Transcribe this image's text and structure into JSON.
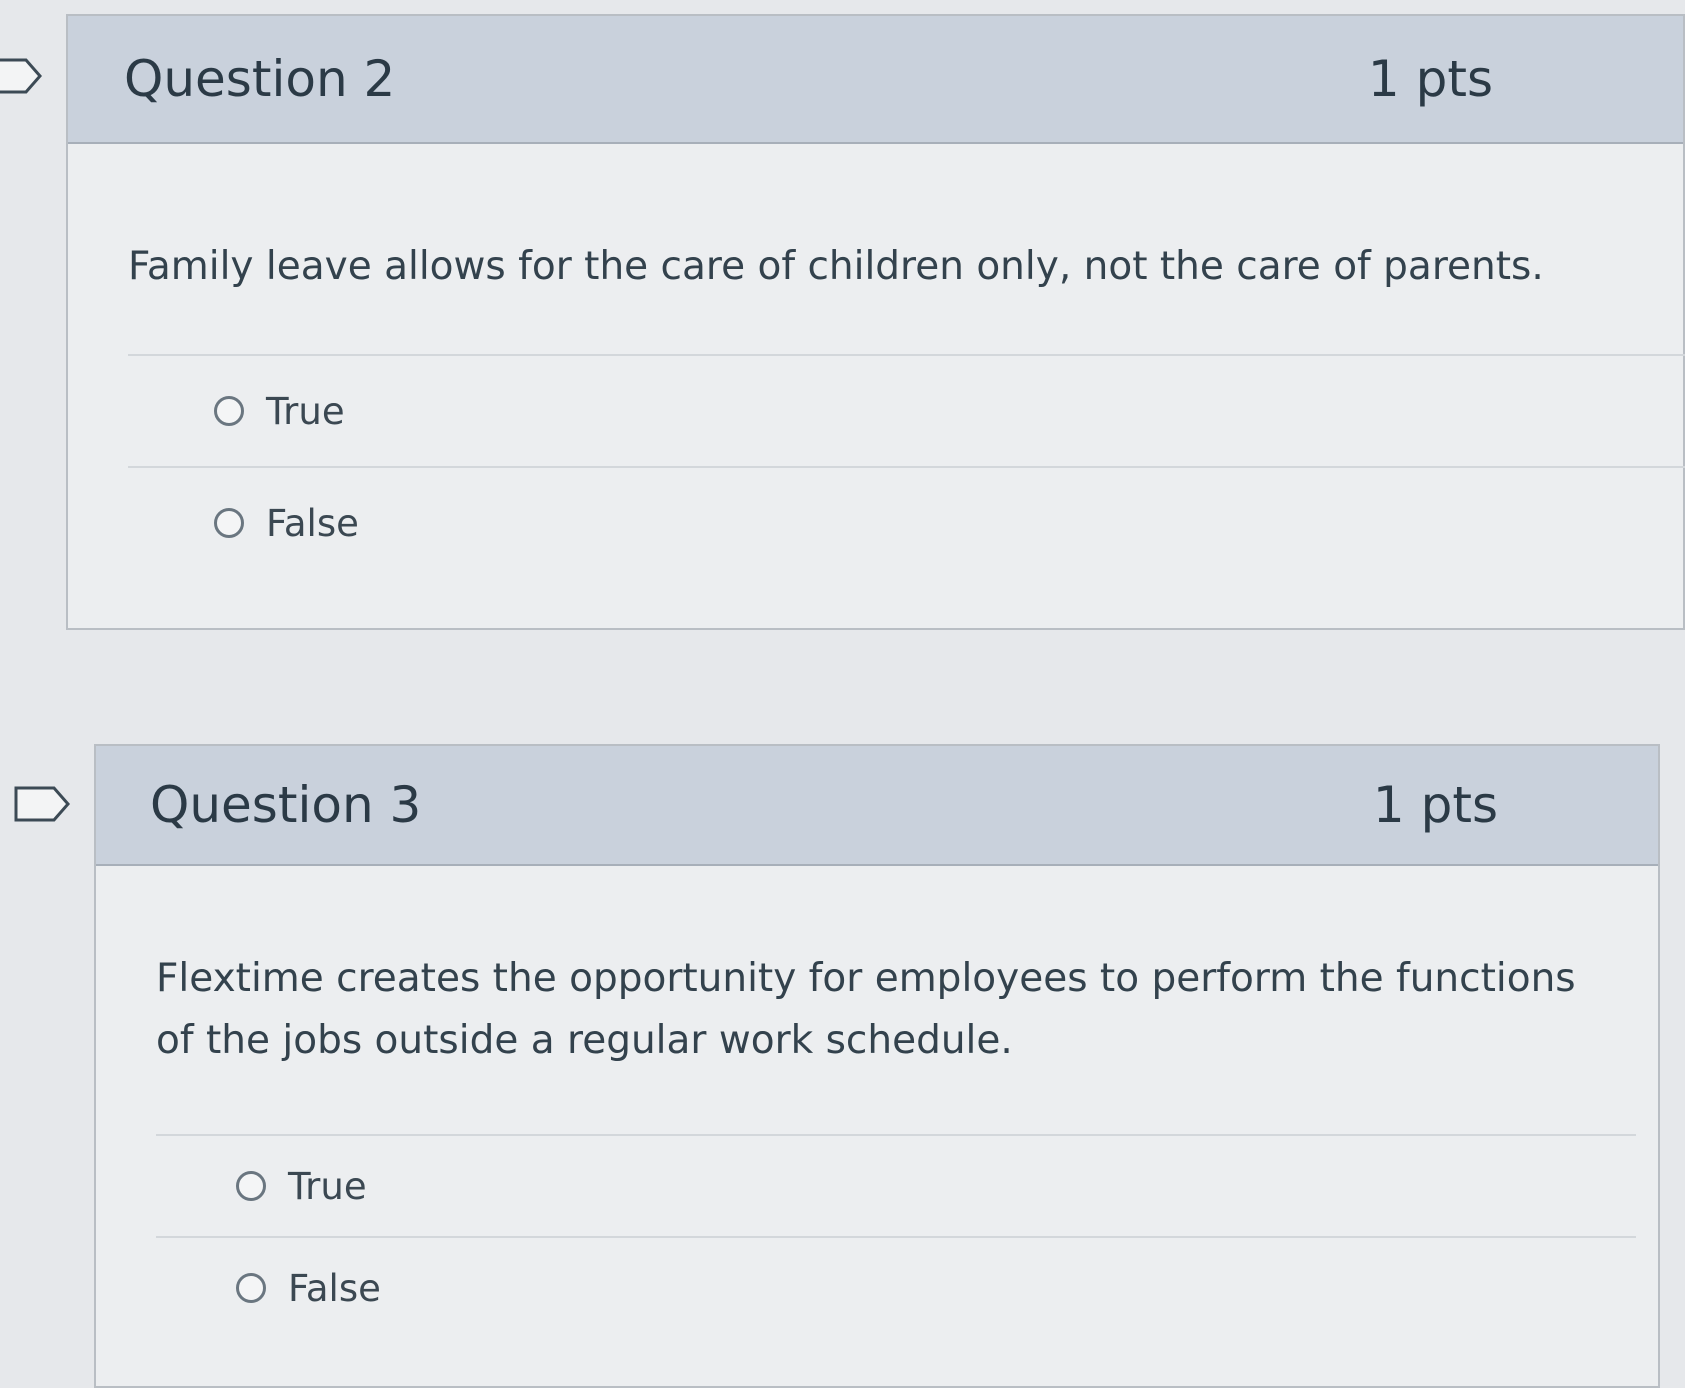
{
  "questions": [
    {
      "title": "Question 2",
      "points": "1 pts",
      "text": "Family leave allows for the care of children only, not the care of parents.",
      "answers": [
        "True",
        "False"
      ]
    },
    {
      "title": "Question 3",
      "points": "1 pts",
      "text": "Flextime creates the opportunity for employees to perform the functions of the jobs outside a regular work schedule.",
      "answers": [
        "True",
        "False"
      ]
    }
  ],
  "icons": {
    "flag": "flag-outline-icon",
    "radio": "radio-unchecked-icon"
  },
  "colors": {
    "header_bg": "#c9d1dc",
    "body_bg": "#eceef0",
    "border": "#b9bec4",
    "text": "#2d3b45"
  }
}
